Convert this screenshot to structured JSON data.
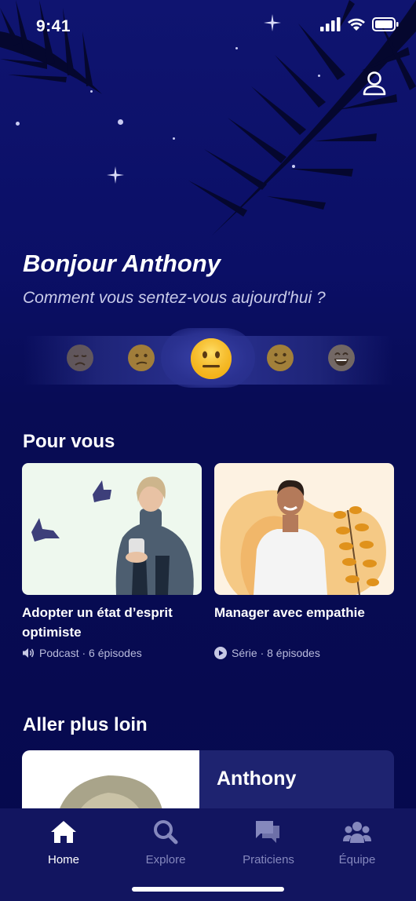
{
  "status_bar": {
    "time": "9:41"
  },
  "header": {
    "greeting": "Bonjour Anthony",
    "question": "Comment vous sentez-vous aujourd'hui ?"
  },
  "mood": {
    "options": [
      "very-sad",
      "sad",
      "neutral",
      "happy",
      "very-happy"
    ],
    "selected": "neutral"
  },
  "for_you": {
    "title": "Pour vous",
    "cards": [
      {
        "title": "Adopter un état d’esprit optimiste",
        "meta": "Podcast · 6 épisodes",
        "icon": "speaker-icon"
      },
      {
        "title": "Manager avec empathie",
        "meta": "Série · 8 épisodes",
        "icon": "play-icon"
      }
    ]
  },
  "go_further": {
    "title": "Aller plus loin",
    "card_name": "Anthony"
  },
  "tabs": [
    {
      "label": "Home",
      "icon": "home-icon",
      "active": true
    },
    {
      "label": "Explore",
      "icon": "search-icon",
      "active": false
    },
    {
      "label": "Praticiens",
      "icon": "chat-icon",
      "active": false
    },
    {
      "label": "Équipe",
      "icon": "team-icon",
      "active": false
    }
  ],
  "colors": {
    "background": "#0a0c58",
    "tab_bar": "#121560",
    "active": "#ffffff",
    "inactive": "#8588bd",
    "mood_yellow": "#f7c21e"
  }
}
